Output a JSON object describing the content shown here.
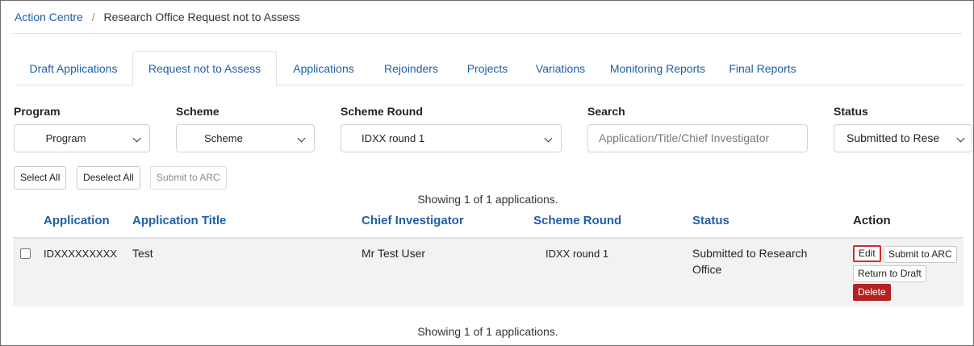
{
  "breadcrumb": {
    "root": "Action Centre",
    "separator": "/",
    "current": "Research Office Request not to Assess"
  },
  "tabs": [
    {
      "label": "Draft Applications",
      "active": false
    },
    {
      "label": "Request not to Assess",
      "active": true
    },
    {
      "label": "Applications",
      "active": false
    },
    {
      "label": "Rejoinders",
      "active": false
    },
    {
      "label": "Projects",
      "active": false
    },
    {
      "label": "Variations",
      "active": false
    },
    {
      "label": "Monitoring Reports",
      "active": false
    },
    {
      "label": "Final Reports",
      "active": false
    }
  ],
  "filters": {
    "program": {
      "label": "Program",
      "value": "Program"
    },
    "scheme": {
      "label": "Scheme",
      "value": "Scheme"
    },
    "scheme_round": {
      "label": "Scheme Round",
      "value": "IDXX round 1"
    },
    "search": {
      "label": "Search",
      "placeholder": "Application/Title/Chief Investigator"
    },
    "status": {
      "label": "Status",
      "value": "Submitted to Rese"
    }
  },
  "bulk_actions": {
    "select_all": "Select All",
    "deselect_all": "Deselect All",
    "submit_to_arc": "Submit to ARC"
  },
  "showing_text": "Showing 1 of 1 applications.",
  "table": {
    "headers": {
      "application": "Application",
      "title": "Application Title",
      "chief_investigator": "Chief Investigator",
      "scheme_round": "Scheme Round",
      "status": "Status",
      "action": "Action"
    },
    "rows": [
      {
        "application": "IDXXXXXXXXX",
        "title": "Test",
        "chief_investigator": "Mr Test User",
        "scheme_round": "IDXX round 1",
        "status_line1": "Submitted to Research",
        "status_line2": "Office",
        "actions": {
          "edit": "Edit",
          "submit": "Submit to ARC",
          "return": "Return to Draft",
          "delete": "Delete"
        }
      }
    ]
  },
  "colors": {
    "link": "#1f5fa8",
    "delete": "#b32121",
    "highlight": "#d42a2a"
  }
}
